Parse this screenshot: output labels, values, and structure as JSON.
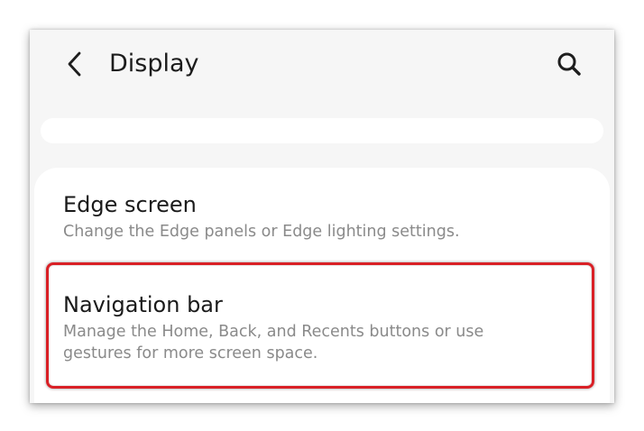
{
  "header": {
    "title": "Display",
    "back_icon": "chevron-left-icon",
    "search_icon": "search-icon"
  },
  "settings": {
    "items": [
      {
        "title": "Edge screen",
        "subtitle": "Change the Edge panels or Edge lighting settings."
      },
      {
        "title": "Navigation bar",
        "subtitle": "Manage the Home, Back, and Recents buttons or use gestures for more screen space."
      }
    ]
  },
  "colors": {
    "highlight_border": "#d92026",
    "background": "#f6f6f6",
    "card": "#ffffff"
  }
}
